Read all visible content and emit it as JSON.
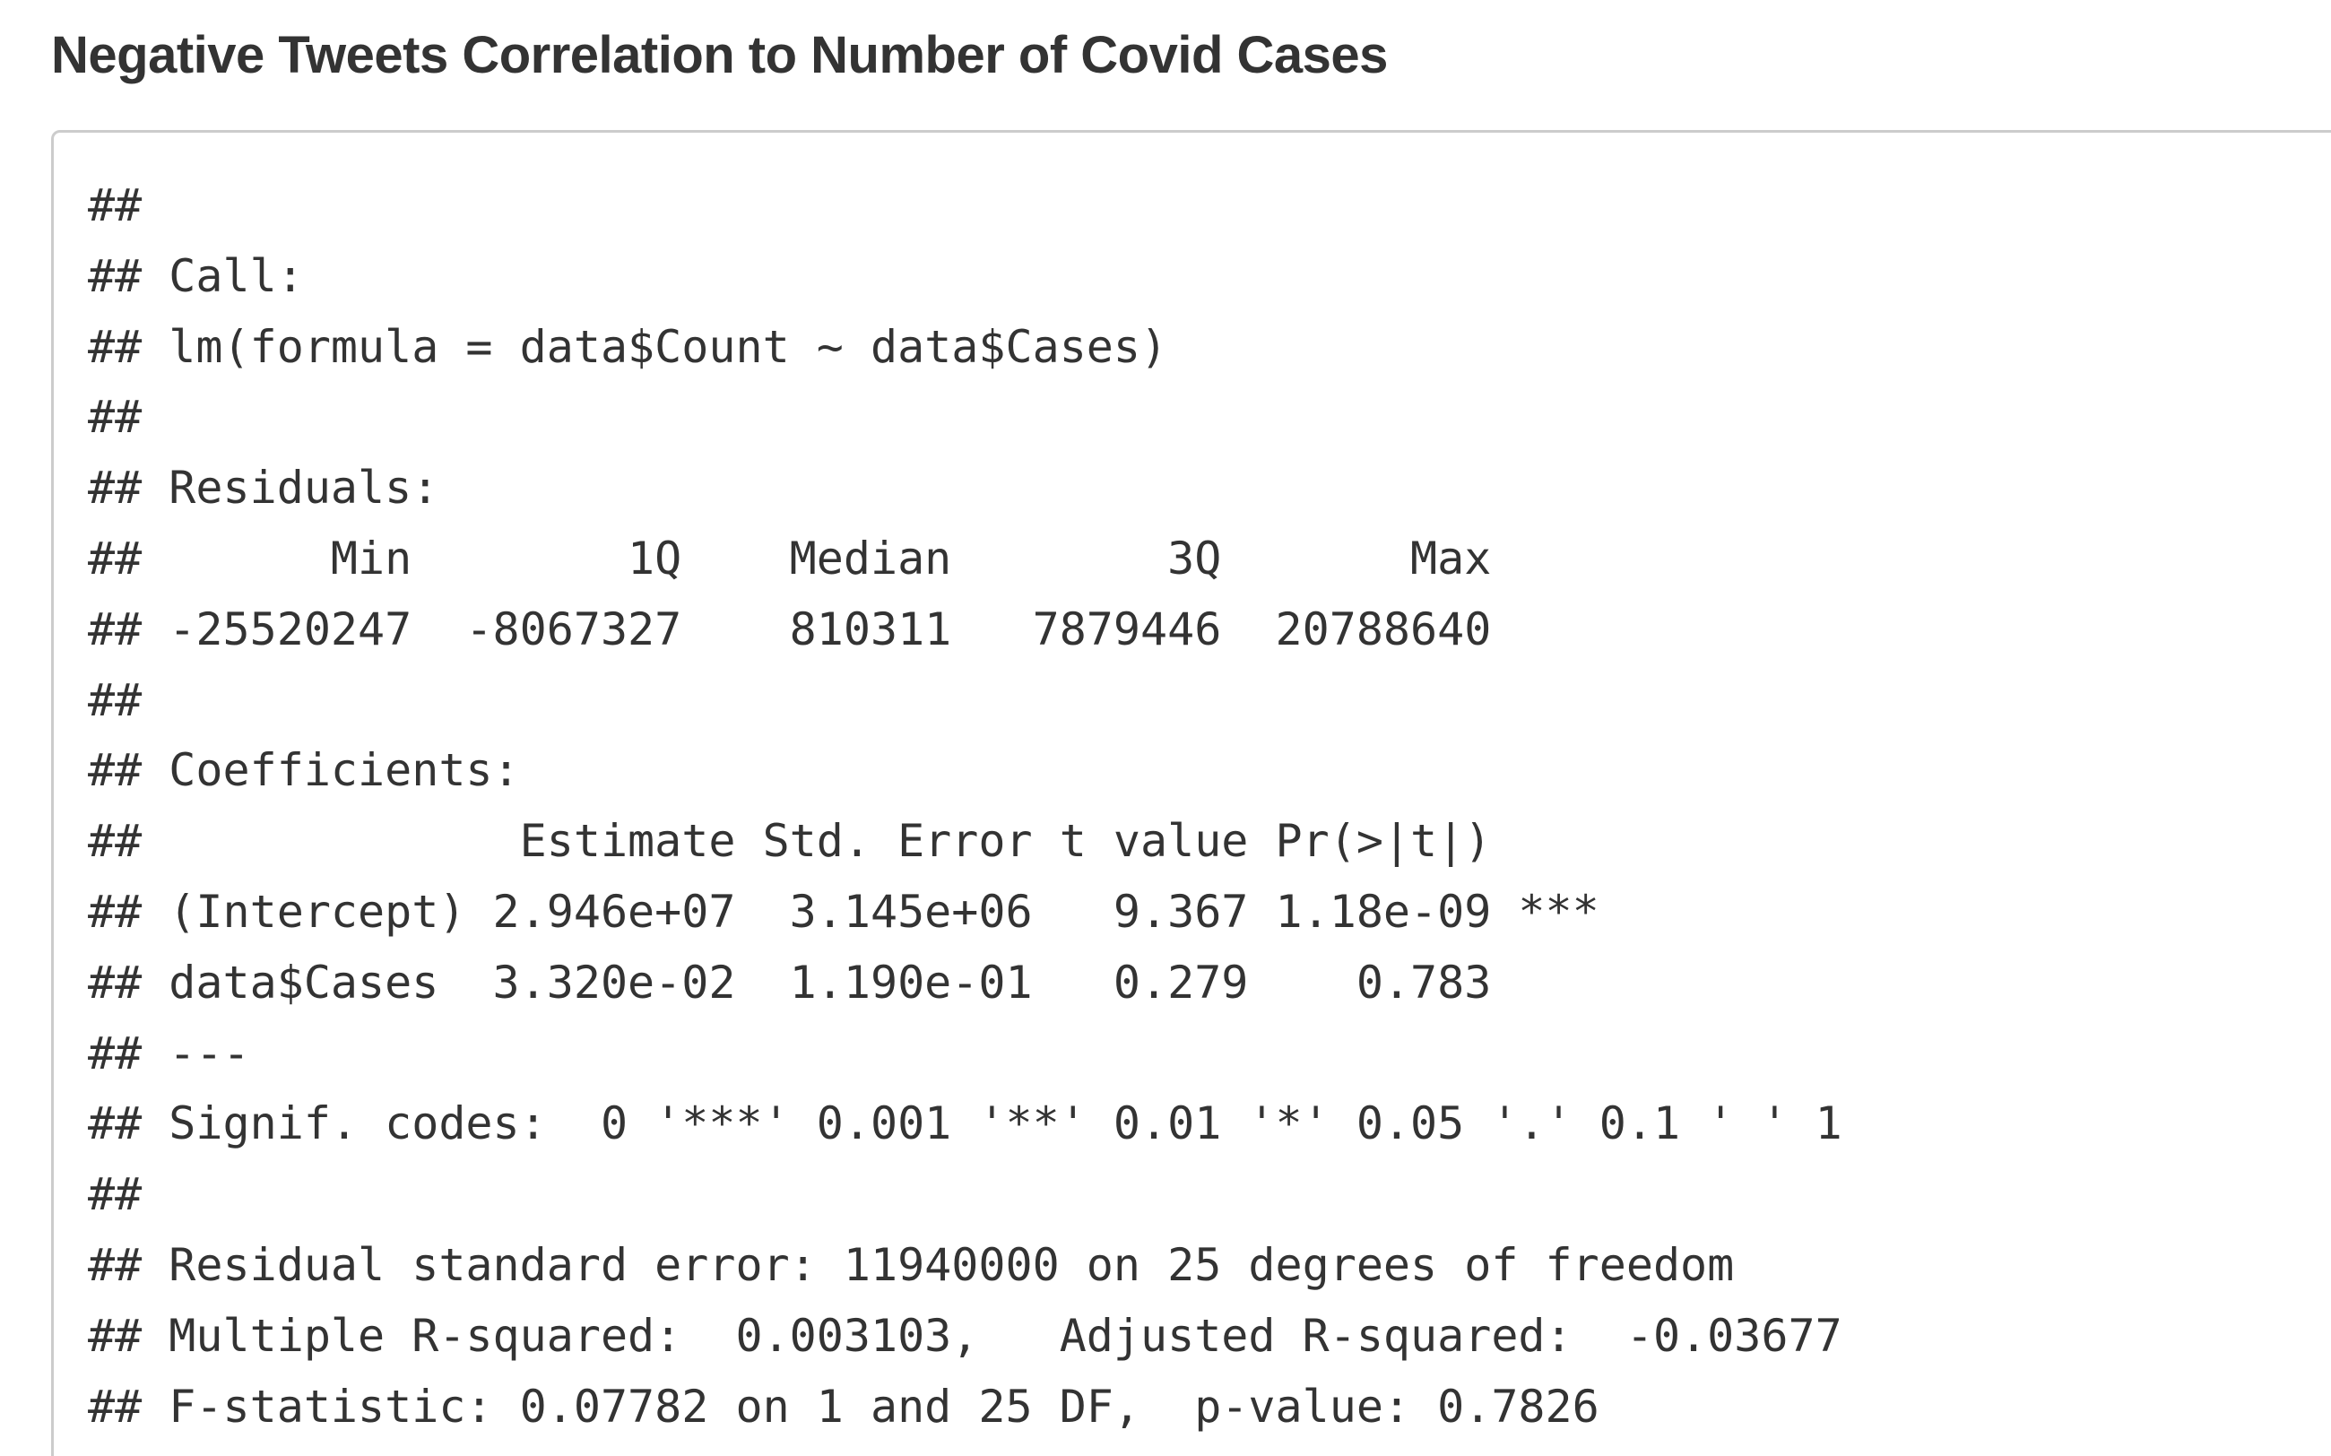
{
  "title": "Negative Tweets Correlation to Number of Covid Cases",
  "output_lines": [
    "##",
    "## Call:",
    "## lm(formula = data$Count ~ data$Cases)",
    "##",
    "## Residuals:",
    "##       Min        1Q    Median        3Q       Max",
    "## -25520247  -8067327    810311   7879446  20788640",
    "##",
    "## Coefficients:",
    "##              Estimate Std. Error t value Pr(>|t|)",
    "## (Intercept) 2.946e+07  3.145e+06   9.367 1.18e-09 ***",
    "## data$Cases  3.320e-02  1.190e-01   0.279    0.783",
    "## ---",
    "## Signif. codes:  0 '***' 0.001 '**' 0.01 '*' 0.05 '.' 0.1 ' ' 1",
    "##",
    "## Residual standard error: 11940000 on 25 degrees of freedom",
    "## Multiple R-squared:  0.003103,   Adjusted R-squared:  -0.03677",
    "## F-statistic: 0.07782 on 1 and 25 DF,  p-value: 0.7826"
  ]
}
